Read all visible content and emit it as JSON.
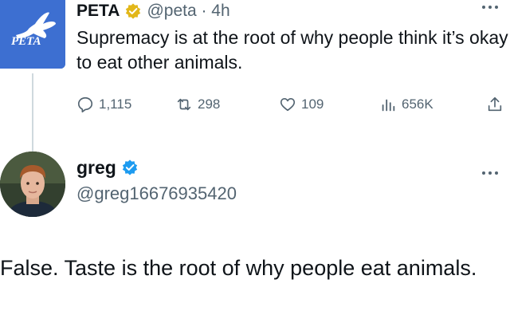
{
  "tweet": {
    "author_name": "PETA",
    "handle_time": "@peta · 4h",
    "text": "Supremacy is at the root of why people think it’s okay to eat other animals.",
    "logo_text": "PETA",
    "stats": {
      "replies": "1,115",
      "retweets": "298",
      "likes": "109",
      "views": "656K"
    }
  },
  "reply": {
    "author_name": "greg",
    "handle": "@greg16676935420",
    "text": "False. Taste is the root of why people eat animals."
  },
  "colors": {
    "verified_gold": "#e2b719",
    "verified_blue": "#1d9bf0",
    "secondary_text": "#536471",
    "peta_blue": "#3d6fd1"
  },
  "icons": [
    "more-icon",
    "reply-icon",
    "retweet-icon",
    "like-icon",
    "views-icon",
    "share-icon",
    "verified-icon"
  ]
}
